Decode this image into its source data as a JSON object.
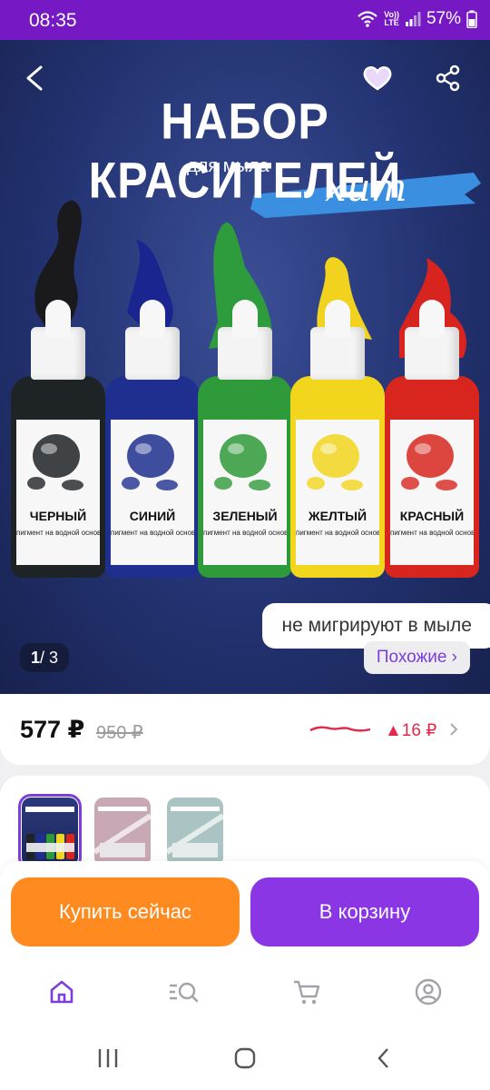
{
  "status_bar": {
    "time": "08:35",
    "network_top": "Vo))",
    "network_bottom": "LTE",
    "battery": "57%"
  },
  "hero": {
    "title": "НАБОР КРАСИТЕЛЕЙ",
    "subtitle": "для мыла",
    "badge": "хит",
    "bottles": [
      {
        "name": "ЧЕРНЫЙ",
        "desc": "пигмент на водной основе",
        "color": "#1e2326"
      },
      {
        "name": "СИНИЙ",
        "desc": "пигмент на водной основе",
        "color": "#1f2f8f"
      },
      {
        "name": "ЗЕЛЕНЫЙ",
        "desc": "пигмент на водной основе",
        "color": "#2f9a3a"
      },
      {
        "name": "ЖЕЛТЫЙ",
        "desc": "пигмент на водной основе",
        "color": "#f2d51d"
      },
      {
        "name": "КРАСНЫЙ",
        "desc": "пигмент на водной основе",
        "color": "#d8261f"
      }
    ],
    "tagline": "не мигрируют в мыле",
    "similar_label": "Похожие ›",
    "pager_current": "1",
    "pager_total": "/ 3"
  },
  "price": {
    "current": "577 ₽",
    "old": "950 ₽",
    "change": "▲16 ₽"
  },
  "actions": {
    "buy_now": "Купить сейчас",
    "add_to_cart": "В корзину"
  },
  "colors": {
    "brand": "#7619c4",
    "buy": "#ff8a1f",
    "cart": "#8b36e5",
    "accent": "#7c3ed9",
    "price_up": "#e5284a"
  },
  "icons": {
    "back": "back-arrow-icon",
    "favorite": "heart-icon",
    "share": "share-icon",
    "home": "home-icon",
    "catalog": "catalog-search-icon",
    "cart": "cart-icon",
    "profile": "profile-icon"
  }
}
